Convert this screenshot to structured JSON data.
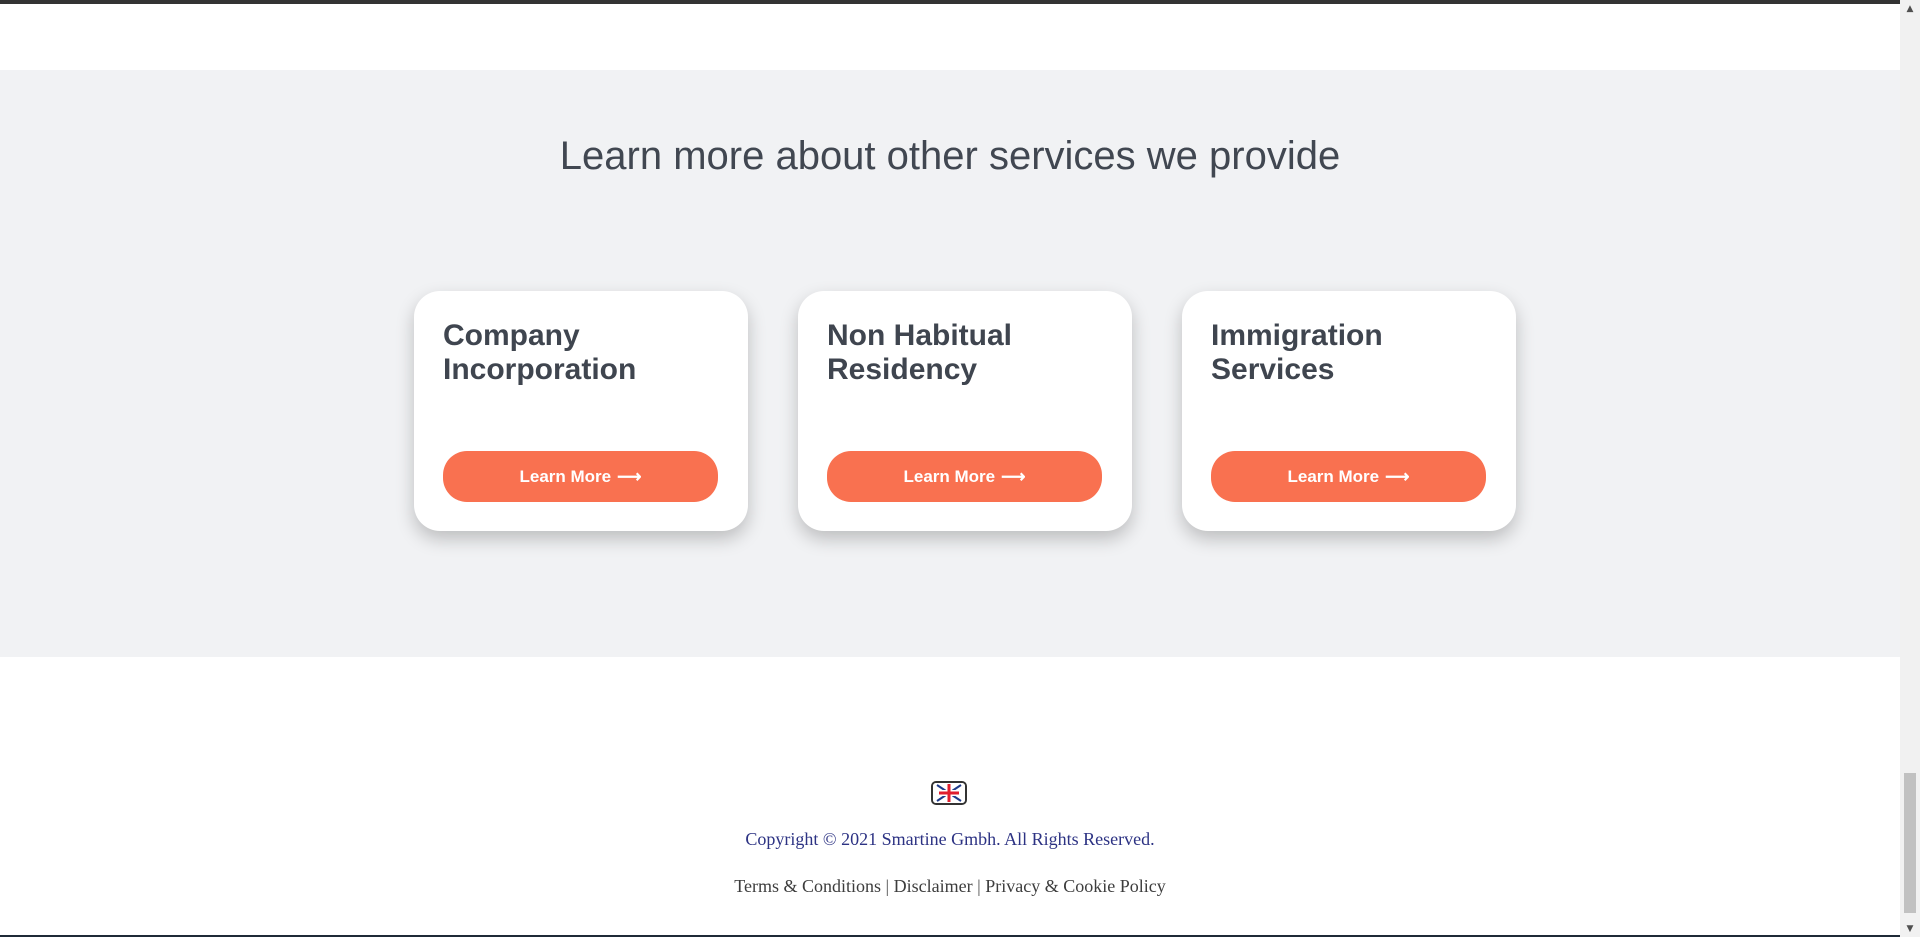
{
  "services": {
    "title": "Learn more about other services we provide",
    "cards": [
      {
        "title": "Company Incorporation",
        "button_label": "Learn More",
        "button_arrow": "⟶"
      },
      {
        "title": "Non Habitual Residency",
        "button_label": "Learn More",
        "button_arrow": "⟶"
      },
      {
        "title": "Immigration Services",
        "button_label": "Learn More",
        "button_arrow": "⟶"
      }
    ]
  },
  "footer": {
    "flag_icon": "uk-flag-icon",
    "copyright": "Copyright © 2021 Smartine Gmbh. All Rights Reserved.",
    "links": [
      "Terms & Conditions",
      "Disclaimer",
      "Privacy & Cookie Policy"
    ],
    "separator": "|"
  },
  "scrollbar": {
    "up_icon": "▲",
    "down_icon": "▼"
  },
  "colors": {
    "accent": "#f97150",
    "section_bg": "#f1f2f4",
    "heading": "#414751",
    "copyright_text": "#2c3283"
  }
}
